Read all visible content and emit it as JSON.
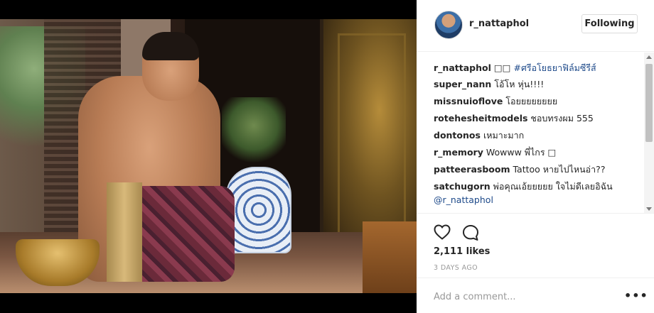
{
  "post": {
    "username": "r_nattaphol",
    "follow_label": "Following",
    "likes": "2,111 likes",
    "time": "3 DAYS AGO",
    "add_comment_placeholder": "Add a comment...",
    "more_icon": "more-options-icon"
  },
  "comments": [
    {
      "user": "r_nattaphol",
      "text": "□□ ",
      "tag": "#ศรีอโยธยาฟิล์มซีรีส์"
    },
    {
      "user": "super_nann",
      "text": "โอ้โห หุ่น!!!!"
    },
    {
      "user": "missnuioflove",
      "text": "โอยยยยยยยย"
    },
    {
      "user": "rotehesheitmodels",
      "text": "ชอบทรงผม 555"
    },
    {
      "user": "dontonos",
      "text": "เหมาะมาก"
    },
    {
      "user": "r_memory",
      "text": "Wowww พี่ไกร □"
    },
    {
      "user": "patteerasboom",
      "text": "Tattoo หายไปไหนอ่า??"
    },
    {
      "user": "satchugorn",
      "text": "พ่อคุณเอ้ยยยยย ใจไม่ดีเลยอิฉัน",
      "mention": "@r_nattaphol"
    }
  ]
}
